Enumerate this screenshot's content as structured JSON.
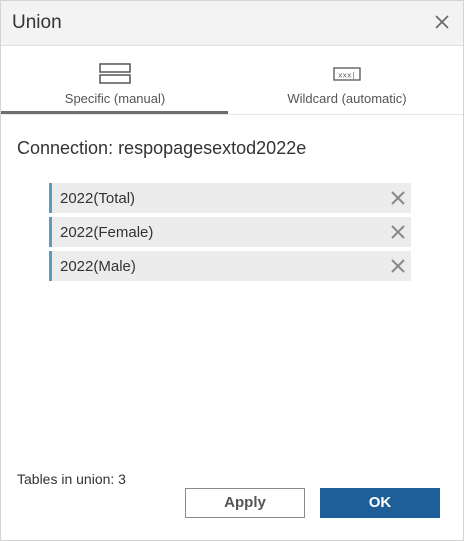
{
  "dialog": {
    "title": "Union"
  },
  "tabs": [
    {
      "label": "Specific (manual)",
      "selected": true,
      "icon": "stacked-tables-icon"
    },
    {
      "label": "Wildcard (automatic)",
      "selected": false,
      "icon": "wildcard-icon",
      "icon_text": "xxx|"
    }
  ],
  "connection": {
    "label": "Connection: respopagesextod2022e"
  },
  "tables": [
    {
      "label": "2022(Total)"
    },
    {
      "label": "2022(Female)"
    },
    {
      "label": "2022(Male)"
    }
  ],
  "footer": {
    "count_text": "Tables in union: 3",
    "apply_label": "Apply",
    "ok_label": "OK"
  },
  "colors": {
    "accent": "#1f5f99",
    "row_marker": "#5b9bc4",
    "row_bg": "#ececec",
    "titlebar_bg": "#f3f3f3"
  }
}
